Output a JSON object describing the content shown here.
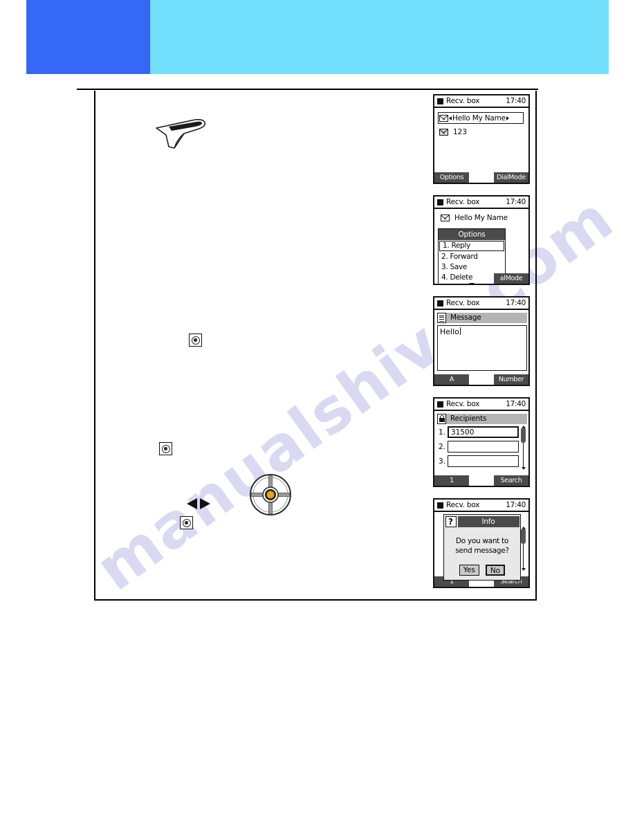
{
  "header": {
    "primary_color": "#3568f6",
    "secondary_color": "#72dffc"
  },
  "watermark": {
    "text": "manualshive.com",
    "color": "#d9d9f2"
  },
  "instructions": {
    "pointer_illustration": "hand-pointer-illustration",
    "keys": [
      {
        "icon": "round-key-icon"
      },
      {
        "icon": "round-key-icon"
      },
      {
        "icon": "round-key-icon"
      }
    ],
    "left_right_arrow": "left-right-arrow-icon",
    "nav_wheel": {
      "icon": "navigation-wheel-icon",
      "center_color": "#f0a020"
    }
  },
  "screens": [
    {
      "id": "inbox-list",
      "status": {
        "title": "Recv. box",
        "time": "17:40"
      },
      "selected_item": {
        "label": "Hello My Name",
        "icon": "envelope-icon"
      },
      "second_item": {
        "label": "123",
        "icon": "envelope-read-icon"
      },
      "softkeys": {
        "left": "Options",
        "right": "DialMode"
      }
    },
    {
      "id": "options-menu",
      "status": {
        "title": "Recv. box",
        "time": "17:40"
      },
      "message_header": {
        "label": "Hello My Name",
        "icon": "envelope-icon"
      },
      "popup": {
        "title": "Options",
        "items": [
          {
            "label": "1. Reply",
            "selected": true
          },
          {
            "label": "2. Forward",
            "selected": false
          },
          {
            "label": "3. Save",
            "selected": false
          },
          {
            "label": "4. Delete",
            "selected": false
          }
        ],
        "more_indicator": "scroll-down-arrow-icon"
      },
      "softkeys": {
        "right": "alMode"
      }
    },
    {
      "id": "message-compose",
      "status": {
        "title": "Recv. box",
        "time": "17:40"
      },
      "field": {
        "label": "Message",
        "icon": "document-icon"
      },
      "text_value": "Hello",
      "softkeys": {
        "left": "A",
        "right": "Number"
      }
    },
    {
      "id": "recipients",
      "status": {
        "title": "Recv. box",
        "time": "17:40"
      },
      "field": {
        "label": "Recipients",
        "icon": "lock-icon"
      },
      "rows": [
        {
          "num": "1.",
          "value": "31500",
          "active": true
        },
        {
          "num": "2.",
          "value": "",
          "active": false
        },
        {
          "num": "3.",
          "value": "",
          "active": false
        }
      ],
      "softkeys": {
        "left": "1",
        "right": "Search"
      }
    },
    {
      "id": "send-confirm",
      "status": {
        "title": "Recv. box",
        "time": "17:40"
      },
      "dialog": {
        "icon": "question-mark-icon",
        "title": "Info",
        "message_line1": "Do you want to",
        "message_line2": "send message?",
        "buttons": [
          {
            "label": "Yes",
            "emphasized": false
          },
          {
            "label": "No",
            "emphasized": true
          }
        ]
      },
      "background_softkeys": {
        "left": "1",
        "right": "Search"
      }
    }
  ]
}
